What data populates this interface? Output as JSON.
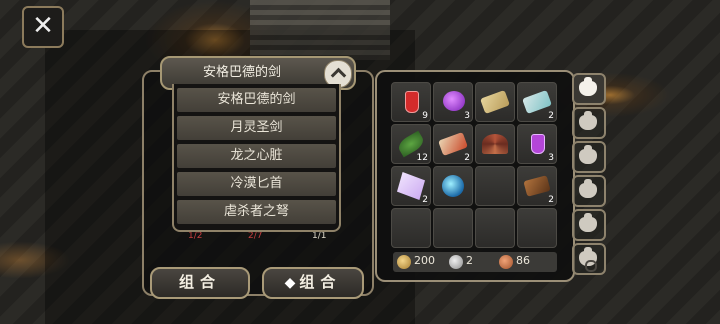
{
  "window": {
    "close_icon": "close-x-icon"
  },
  "dropdown": {
    "selected": "安格巴德的剑",
    "items": [
      "安格巴德的剑",
      "月灵圣剑",
      "龙之心脏",
      "冷漠匕首",
      "虐杀者之弩"
    ]
  },
  "craft": {
    "counters": [
      "1/2",
      "2/7",
      "1/1"
    ],
    "combine_label": "组合",
    "gem_combine_label": "组合"
  },
  "inventory": {
    "slots": [
      {
        "icon": "red-potion-icon",
        "count": "9"
      },
      {
        "icon": "purple-potion-icon",
        "count": "3"
      },
      {
        "icon": "gold-scroll-icon",
        "count": ""
      },
      {
        "icon": "blue-scroll-icon",
        "count": "2"
      },
      {
        "icon": "green-leaf-icon",
        "count": "12"
      },
      {
        "icon": "red-scroll-icon",
        "count": "2"
      },
      {
        "icon": "shell-icon",
        "count": ""
      },
      {
        "icon": "small-purple-potion-icon",
        "count": "3"
      },
      {
        "icon": "crystal-icon",
        "count": "2"
      },
      {
        "icon": "blue-orb-icon",
        "count": ""
      },
      {
        "icon": "",
        "count": ""
      },
      {
        "icon": "brown-scroll-icon",
        "count": "2"
      }
    ],
    "currency": {
      "gold": "200",
      "silver": "2",
      "copper": "86"
    }
  },
  "bag_tabs": [
    "bag-tab-1",
    "bag-tab-2",
    "bag-tab-3",
    "bag-tab-4",
    "bag-tab-5",
    "bag-tab-quest"
  ]
}
